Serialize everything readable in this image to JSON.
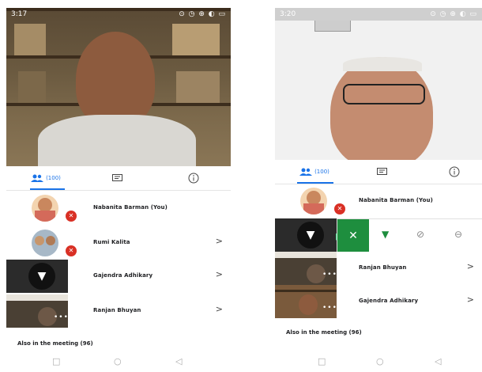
{
  "left": {
    "status": {
      "time": "3:17",
      "icons": "⊙ ◷ ⊕ ◐ ▭"
    },
    "tabs": {
      "people_count": "(100)"
    },
    "participants": [
      {
        "name": "Nabanita Barman (You)"
      },
      {
        "name": "Rumi Kalita"
      },
      {
        "name": "Gajendra Adhikary"
      },
      {
        "name": "Ranjan Bhuyan"
      }
    ],
    "section_title": "Also in the meeting (96)"
  },
  "right": {
    "status": {
      "time": "3:20",
      "icons": "⊙ ◷ ⊕ ◐ ▭"
    },
    "tabs": {
      "people_count": "(100)"
    },
    "participants": [
      {
        "name": "Nabanita Barman (You)"
      },
      {
        "name": "Ranjan Bhuyan"
      },
      {
        "name": "Gajendra Adhikary"
      }
    ],
    "section_title": "Also in the meeting (96)"
  },
  "icons": {
    "people": "people-icon",
    "chat": "chat-icon",
    "info": "info-icon",
    "mic_off": "mic-off-icon",
    "pin": "pin-icon",
    "close": "close-icon",
    "chevron": "chevron-right-icon"
  },
  "colors": {
    "accent": "#1a73e8",
    "mute_red": "#d93025",
    "green": "#1e8e3e"
  }
}
